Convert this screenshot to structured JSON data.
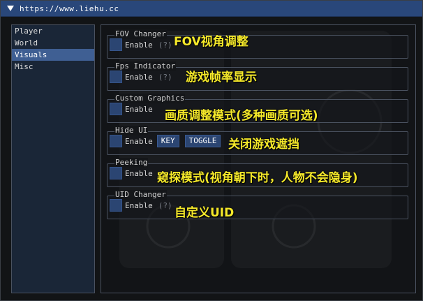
{
  "window": {
    "title": "https://www.liehu.cc"
  },
  "sidebar": {
    "items": [
      {
        "label": "Player",
        "active": false
      },
      {
        "label": "World",
        "active": false
      },
      {
        "label": "Visuals",
        "active": true
      },
      {
        "label": "Misc",
        "active": false
      }
    ]
  },
  "features": [
    {
      "label": "FOV Changer",
      "enable": "Enable",
      "help": "(?)",
      "annotation": "FOV视角调整"
    },
    {
      "label": "Fps Indicator",
      "enable": "Enable",
      "help": "(?)",
      "annotation": "游戏帧率显示"
    },
    {
      "label": "Custom Graphics",
      "enable": "Enable",
      "annotation": "画质调整模式(多种画质可选)"
    },
    {
      "label": "Hide UI",
      "enable": "Enable",
      "key_button": "KEY",
      "toggle_button": "TOGGLE",
      "annotation": "关闭游戏遮挡"
    },
    {
      "label": "Peeking",
      "enable": "Enable",
      "annotation": "窥探模式(视角朝下时，人物不会隐身)"
    },
    {
      "label": "UID Changer",
      "enable": "Enable",
      "help": "(?)",
      "annotation": "自定义UID"
    }
  ],
  "colors": {
    "titlebar": "#29477a",
    "accent": "#2b4572",
    "selected": "#3f5f93",
    "annotation": "#f5e92a"
  }
}
